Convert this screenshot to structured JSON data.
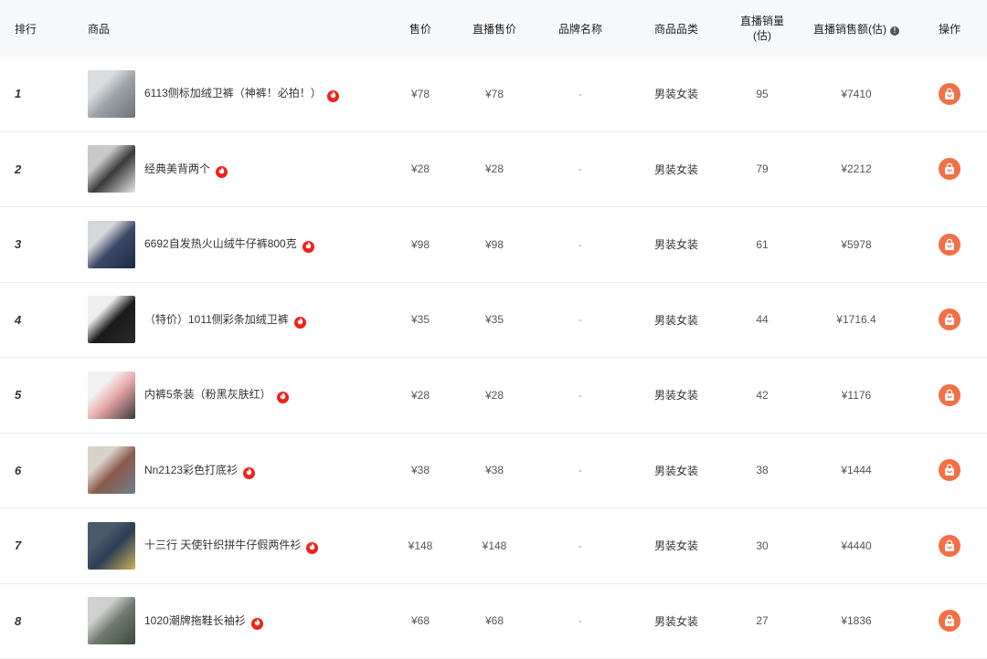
{
  "header": {
    "rank": "排行",
    "product": "商品",
    "price": "售价",
    "live_price": "直播售价",
    "brand": "品牌名称",
    "category": "商品品类",
    "live_volume_line1": "直播销量",
    "live_volume_line2": "(估)",
    "live_amount": "直播销售额(估)",
    "info_glyph": "!",
    "operation": "操作"
  },
  "rows": [
    {
      "rank": "1",
      "name": "6113侧标加绒卫裤（神裤！必拍！）",
      "price": "¥78",
      "live_price": "¥78",
      "brand": "-",
      "category": "男装女装",
      "volume": "95",
      "amount": "¥7410",
      "thumb": [
        "#d9dde0",
        "#9aa0a5",
        "#6d7378"
      ]
    },
    {
      "rank": "2",
      "name": "经典美背两个",
      "price": "¥28",
      "live_price": "¥28",
      "brand": "-",
      "category": "男装女装",
      "volume": "79",
      "amount": "¥2212",
      "thumb": [
        "#c8c8c8",
        "#3a3a3a",
        "#e6e6e6"
      ]
    },
    {
      "rank": "3",
      "name": "6692自发热火山绒牛仔裤800克",
      "price": "¥98",
      "live_price": "¥98",
      "brand": "-",
      "category": "男装女装",
      "volume": "61",
      "amount": "¥5978",
      "thumb": [
        "#d5d8da",
        "#3b4a66",
        "#1e2a44"
      ]
    },
    {
      "rank": "4",
      "name": "（特价）1011侧彩条加绒卫裤",
      "price": "¥35",
      "live_price": "¥35",
      "brand": "-",
      "category": "男装女装",
      "volume": "44",
      "amount": "¥1716.4",
      "thumb": [
        "#eeeeee",
        "#1a1a1a",
        "#2b2b2b"
      ]
    },
    {
      "rank": "5",
      "name": "内裤5条装（粉黑灰肤红）",
      "price": "¥28",
      "live_price": "¥28",
      "brand": "-",
      "category": "男装女装",
      "volume": "42",
      "amount": "¥1176",
      "thumb": [
        "#f2f2f2",
        "#e8a7a8",
        "#3a3a3a"
      ]
    },
    {
      "rank": "6",
      "name": "Nn2123彩色打底衫",
      "price": "¥38",
      "live_price": "¥38",
      "brand": "-",
      "category": "男装女装",
      "volume": "38",
      "amount": "¥1444",
      "thumb": [
        "#d8d2c8",
        "#8b5a4a",
        "#6e7f8f"
      ]
    },
    {
      "rank": "7",
      "name": "十三行 天使针织拼牛仔假两件衫",
      "price": "¥148",
      "live_price": "¥148",
      "brand": "-",
      "category": "男装女装",
      "volume": "30",
      "amount": "¥4440",
      "thumb": [
        "#4a5a6a",
        "#2d3d55",
        "#c9b25a"
      ]
    },
    {
      "rank": "8",
      "name": "1020潮牌拖鞋长袖衫",
      "price": "¥68",
      "live_price": "¥68",
      "brand": "-",
      "category": "男装女装",
      "volume": "27",
      "amount": "¥1836",
      "thumb": [
        "#d0d0d0",
        "#707a70",
        "#3a4a3a"
      ]
    }
  ],
  "icons": {
    "hot": "flame-icon",
    "buy": "shopping-bag-icon",
    "info": "info-icon"
  },
  "colors": {
    "hot": "#f0221a",
    "buy": "#f36f45",
    "header_bg": "#f7f8fa"
  }
}
